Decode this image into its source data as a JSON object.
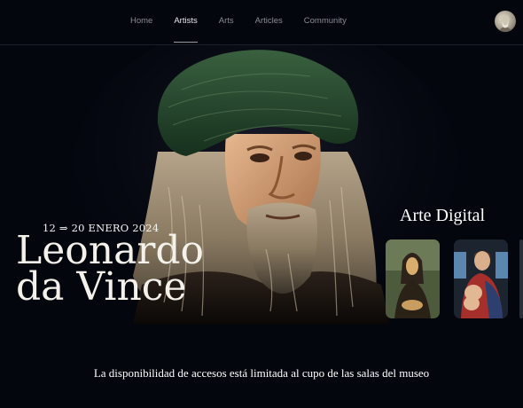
{
  "nav": {
    "items": [
      {
        "label": "Home",
        "active": false
      },
      {
        "label": "Artists",
        "active": true
      },
      {
        "label": "Arts",
        "active": false
      },
      {
        "label": "Articles",
        "active": false
      },
      {
        "label": "Community",
        "active": false
      }
    ]
  },
  "hero": {
    "dates": "12 ⇒ 20 ENERO 2024",
    "title_line1": "Leonardo",
    "title_line2": "da Vince",
    "brand": "Arte Digital"
  },
  "gallery": {
    "items": [
      {
        "name": "Mona Lisa thumbnail"
      },
      {
        "name": "Madonna Litta thumbnail"
      }
    ]
  },
  "notice": "La disponibilidad de accesos está limitada al cupo de las salas del museo",
  "colors": {
    "background": "#04060e",
    "turban": "#2a4a30",
    "nav_active": "#e8e8ec",
    "nav_inactive": "#8a8c94"
  }
}
